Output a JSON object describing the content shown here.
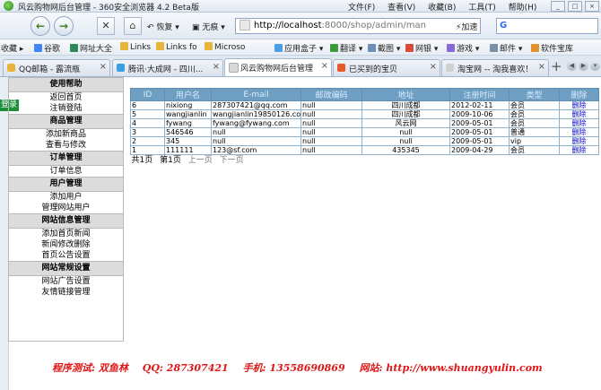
{
  "window": {
    "title": "风云购物网后台管理 - 360安全浏览器 4.2 Beta版",
    "menus": [
      "文件(F)",
      "查看(V)",
      "收藏(B)",
      "工具(T)",
      "帮助(H)"
    ]
  },
  "toolbar": {
    "restore_label": "恢复",
    "no_mark_label": "无痕",
    "address_host": "http://localhost",
    "address_rest": ":8000/shop/admin/man",
    "accelerate_label": "加速"
  },
  "bookmarks": [
    "收藏",
    "谷歌",
    "网址大全",
    "Links",
    "Links fo",
    "Microso",
    "应用盒子",
    "翻译",
    "截图",
    "网银",
    "游戏",
    "邮件",
    "软件宝库"
  ],
  "tabs": [
    "QQ邮箱 - 露流瓶",
    "腾讯·大成网 - 四川...",
    "风云购物网后台管理",
    "已买到的宝贝",
    "淘宝网 -- 淘我喜欢！"
  ],
  "left_edge": {
    "login_label": "登录"
  },
  "menu": {
    "groups": [
      {
        "title": "使用帮助",
        "items": [
          "返回首页",
          "注销登陆"
        ]
      },
      {
        "title": "商品管理",
        "items": [
          "添加新商品",
          "查看与修改"
        ]
      },
      {
        "title": "订单管理",
        "items": [
          "订单信息"
        ]
      },
      {
        "title": "用户管理",
        "items": [
          "添加用户",
          "管理网站用户"
        ]
      },
      {
        "title": "网站信息管理",
        "items": [
          "添加首页新闻",
          "新闻修改删除",
          "首页公告设置"
        ]
      },
      {
        "title": "网站常规设置",
        "items": [
          "网站广告设置",
          "友情链接管理"
        ]
      }
    ]
  },
  "users_table": {
    "columns": [
      "ID",
      "用户名",
      "E-mail",
      "邮政编码",
      "地址",
      "注册时间",
      "类型",
      "删除"
    ],
    "rows": [
      [
        "6",
        "nixiong",
        "287307421@qq.com",
        "null",
        "四川成都",
        "2012-02-11",
        "会员",
        "删除"
      ],
      [
        "5",
        "wangjianlin",
        "wangjianlin19850126.com",
        "null",
        "四川成都",
        "2009-10-06",
        "会员",
        "删除"
      ],
      [
        "4",
        "fywang",
        "fywang@fywang.com",
        "null",
        "风云网",
        "2009-05-01",
        "会员",
        "删除"
      ],
      [
        "3",
        "546546",
        "null",
        "null",
        "null",
        "2009-05-01",
        "普通",
        "删除"
      ],
      [
        "2",
        "345",
        "null",
        "null",
        "null",
        "2009-05-01",
        "vip",
        "删除"
      ],
      [
        "1",
        "111111",
        "123@sf.com",
        "null",
        "435345",
        "2009-04-29",
        "会员",
        "删除"
      ]
    ],
    "pager": {
      "total": "共1页",
      "current": "第1页",
      "prev": "上一页",
      "next": "下一页"
    }
  },
  "credit": {
    "tester": "程序测试: 双鱼林",
    "qq": "QQ: 287307421",
    "phone": "手机: 13558690869",
    "site": "网站: http://www.shuangyulin.com"
  }
}
